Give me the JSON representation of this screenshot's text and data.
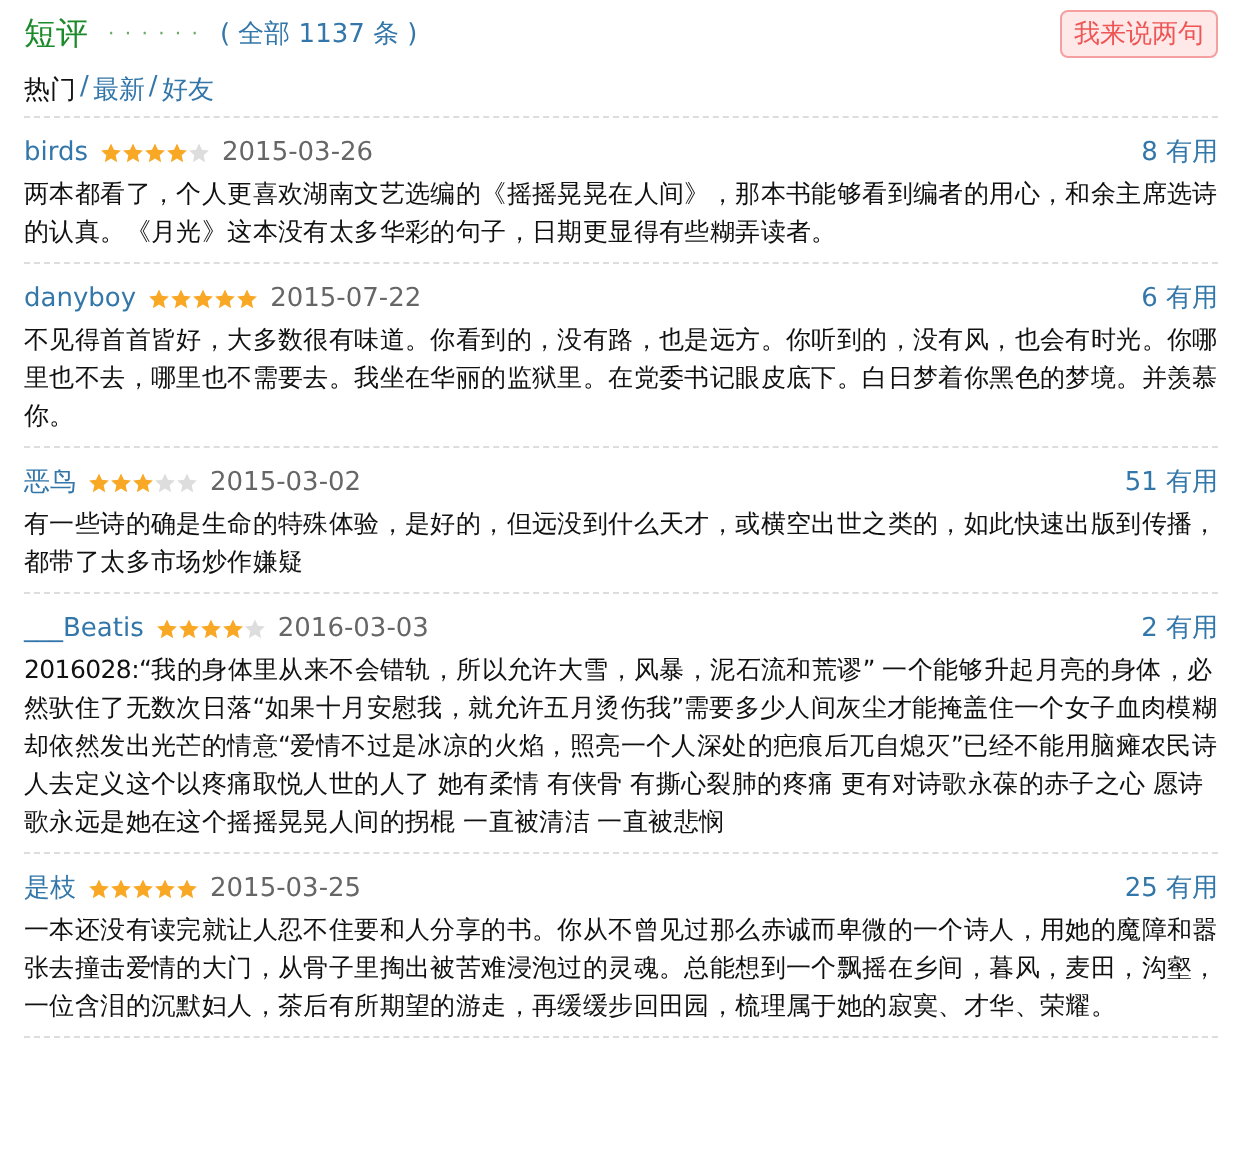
{
  "header": {
    "title": "短评",
    "dots": "· · · · · ·",
    "count": "( 全部 1137 条 )",
    "button": "我来说两句"
  },
  "tabs": [
    {
      "label": "热门",
      "selected": true
    },
    {
      "label": "最新",
      "selected": false
    },
    {
      "label": "好友",
      "selected": false
    }
  ],
  "separator": "/",
  "reviews": [
    {
      "user": "birds",
      "stars": 4,
      "date": "2015-03-26",
      "votes": "8",
      "vote_label": "有用",
      "text": "两本都看了，个人更喜欢湖南文艺选编的《摇摇晃晃在人间》，那本书能够看到编者的用心，和余主席选诗的认真。《月光》这本没有太多华彩的句子，日期更显得有些糊弄读者。"
    },
    {
      "user": "danyboy",
      "stars": 5,
      "date": "2015-07-22",
      "votes": "6",
      "vote_label": "有用",
      "text": "不见得首首皆好，大多数很有味道。你看到的，没有路，也是远方。你听到的，没有风，也会有时光。你哪里也不去，哪里也不需要去。我坐在华丽的监狱里。在党委书记眼皮底下。白日梦着你黑色的梦境。并羡慕你。"
    },
    {
      "user": "恶鸟",
      "stars": 3,
      "date": "2015-03-02",
      "votes": "51",
      "vote_label": "有用",
      "text": "有一些诗的确是生命的特殊体验，是好的，但远没到什么天才，或横空出世之类的，如此快速出版到传播，都带了太多市场炒作嫌疑"
    },
    {
      "user": "___Beatis",
      "stars": 4,
      "date": "2016-03-03",
      "votes": "2",
      "vote_label": "有用",
      "text": "2016028:“我的身体里从来不会错轨，所以允许大雪，风暴，泥石流和荒谬” 一个能够升起月亮的身体，必然驮住了无数次日落“如果十月安慰我，就允许五月烫伤我”需要多少人间灰尘才能掩盖住一个女子血肉模糊却依然发出光芒的情意“爱情不过是冰凉的火焰，照亮一个人深处的疤痕后兀自熄灭”已经不能用脑瘫农民诗人去定义这个以疼痛取悦人世的人了 她有柔情 有侠骨 有撕心裂肺的疼痛 更有对诗歌永葆的赤子之心 愿诗歌永远是她在这个摇摇晃晃人间的拐棍 一直被清洁 一直被悲悯"
    },
    {
      "user": "是枝",
      "stars": 5,
      "date": "2015-03-25",
      "votes": "25",
      "vote_label": "有用",
      "text": "一本还没有读完就让人忍不住要和人分享的书。你从不曾见过那么赤诚而卑微的一个诗人，用她的魔障和嚣张去撞击爱情的大门，从骨子里掏出被苦难浸泡过的灵魂。总能想到一个飘摇在乡间，暮风，麦田，沟壑，一位含泪的沉默妇人，茶后有所期望的游走，再缓缓步回田园，梳理属于她的寂寞、才华、荣耀。"
    }
  ]
}
